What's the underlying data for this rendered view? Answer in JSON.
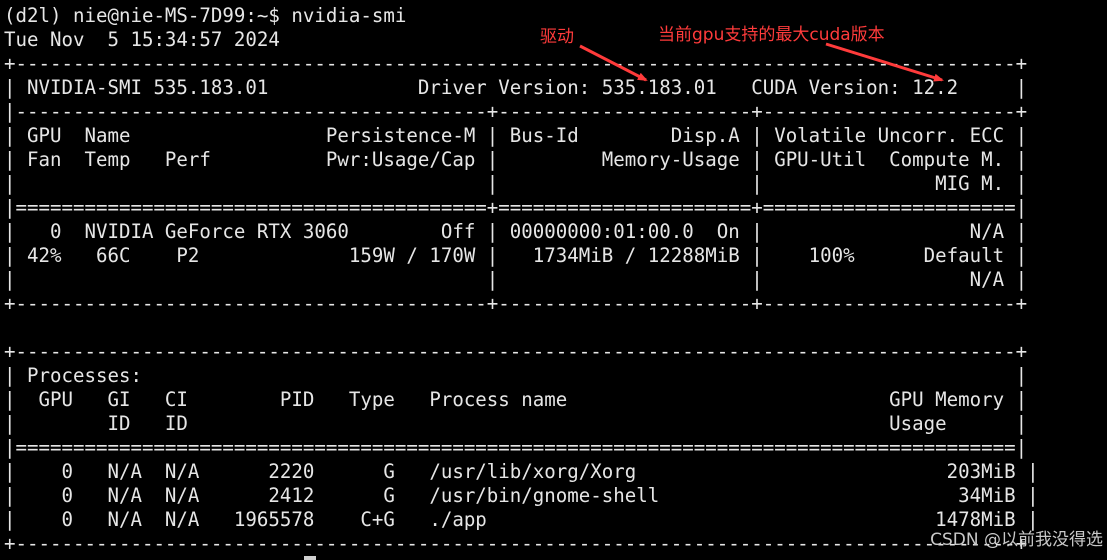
{
  "terminal": {
    "lines": [
      "(d2l) nie@nie-MS-7D99:~$ nvidia-smi",
      "Tue Nov  5 15:34:57 2024",
      "+---------------------------------------------------------------------------------------+",
      "| NVIDIA-SMI 535.183.01             Driver Version: 535.183.01   CUDA Version: 12.2     |",
      "|-----------------------------------------+----------------------+----------------------+",
      "| GPU  Name                 Persistence-M | Bus-Id        Disp.A | Volatile Uncorr. ECC |",
      "| Fan  Temp   Perf          Pwr:Usage/Cap |         Memory-Usage | GPU-Util  Compute M. |",
      "|                                         |                      |               MIG M. |",
      "|=========================================+======================+======================|",
      "|   0  NVIDIA GeForce RTX 3060        Off | 00000000:01:00.0  On |                  N/A |",
      "| 42%   66C    P2             159W / 170W |   1734MiB / 12288MiB |    100%      Default |",
      "|                                         |                      |                  N/A |",
      "+-----------------------------------------+----------------------+----------------------+",
      "",
      "+---------------------------------------------------------------------------------------+",
      "| Processes:                                                                            |",
      "|  GPU   GI   CI        PID   Type   Process name                            GPU Memory |",
      "|        ID   ID                                                             Usage      |",
      "|=======================================================================================|",
      "|    0   N/A  N/A      2220      G   /usr/lib/xorg/Xorg                           203MiB |",
      "|    0   N/A  N/A      2412      G   /usr/bin/gnome-shell                          34MiB |",
      "|    0   N/A  N/A   1965578    C+G   ./app                                       1478MiB |",
      "+---------------------------------------------------------------------------------------+"
    ]
  },
  "annotations": {
    "driver_label": "驱动",
    "cuda_label": "当前gpu支持的最大cuda版本",
    "color": "#ff3b3b"
  },
  "watermark": "CSDN @以前我没得选"
}
